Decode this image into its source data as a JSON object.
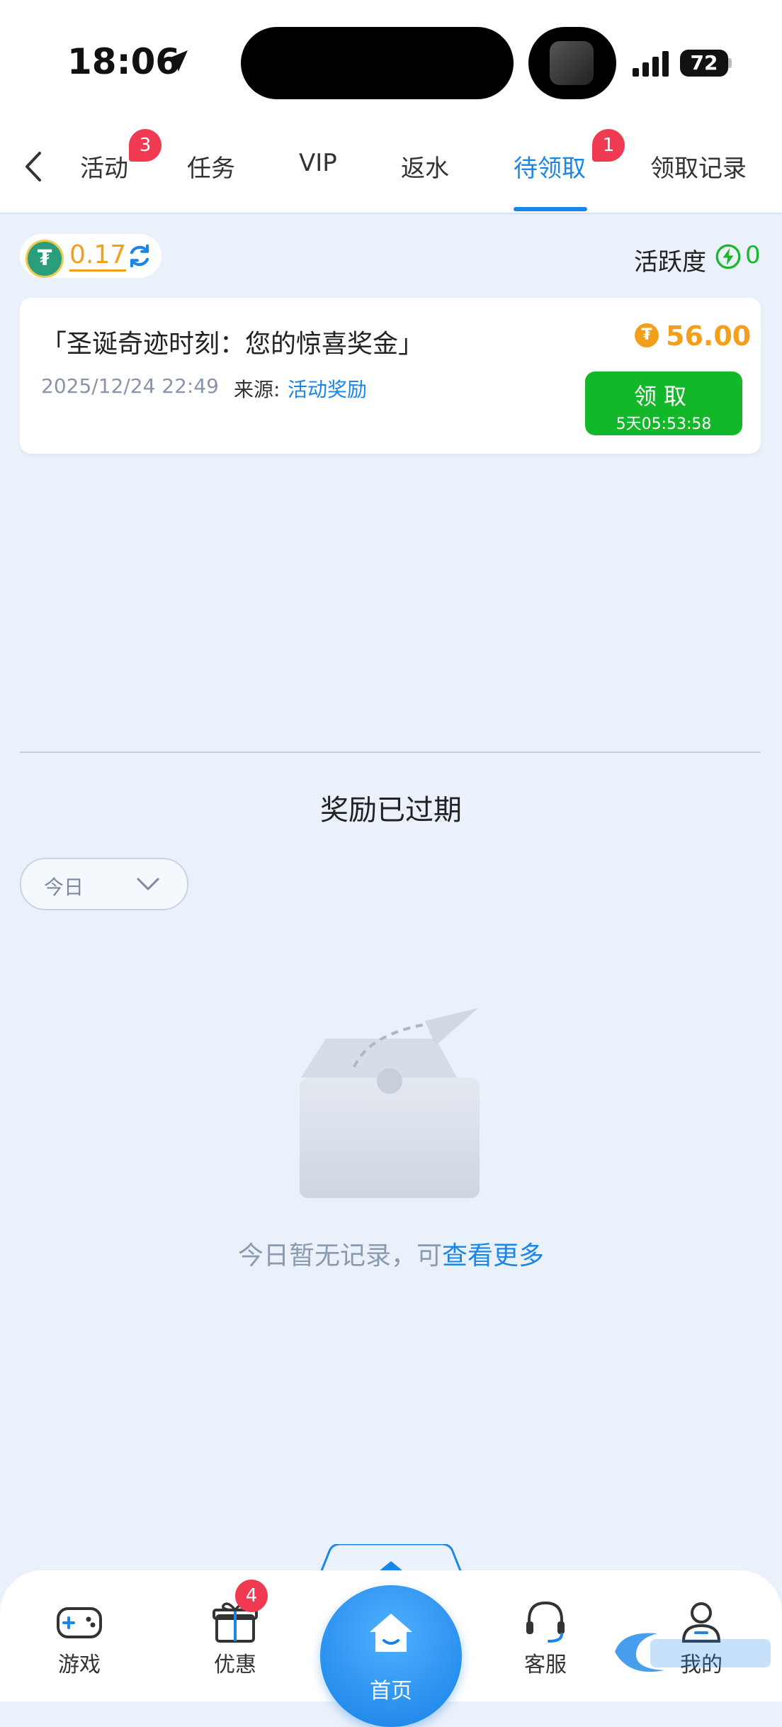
{
  "status_bar": {
    "time": "18:06",
    "battery": "72"
  },
  "tabs": [
    {
      "label": "活动",
      "badge": "3"
    },
    {
      "label": "任务"
    },
    {
      "label": "VIP"
    },
    {
      "label": "返水"
    },
    {
      "label": "待领取",
      "badge": "1",
      "active": true
    },
    {
      "label": "领取记录"
    }
  ],
  "balance": {
    "value": "0.17",
    "currency_icon": "usdt-icon"
  },
  "activity": {
    "label": "活跃度",
    "value": "0"
  },
  "reward_card": {
    "title": "「圣诞奇迹时刻：您的惊喜奖金」",
    "date": "2025/12/24 22:49",
    "source_label": "来源:",
    "source": "活动奖励",
    "amount": "56.00",
    "claim_label": "领取",
    "countdown": "5天05:53:58"
  },
  "expired": {
    "title": "奖励已过期",
    "filter_value": "今日",
    "empty_text": "今日暂无记录，可",
    "empty_link": "查看更多"
  },
  "bottom_nav": {
    "games": "游戏",
    "promo": "优惠",
    "promo_badge": "4",
    "home": "首页",
    "service": "客服",
    "me": "我的"
  },
  "colors": {
    "accent": "#1a86e8",
    "success": "#12b829",
    "coin": "#f2a01c",
    "badge": "#f03a52"
  }
}
